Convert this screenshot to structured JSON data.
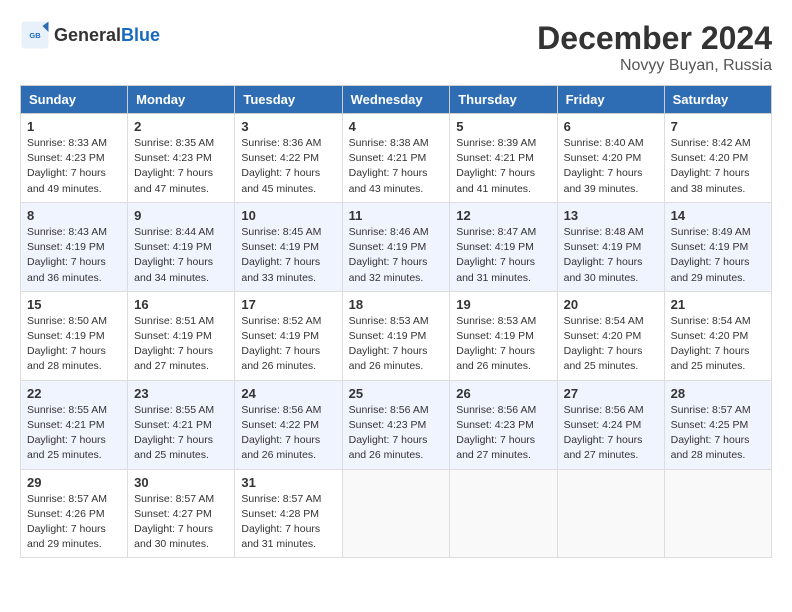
{
  "header": {
    "logo_general": "General",
    "logo_blue": "Blue",
    "month": "December 2024",
    "location": "Novyy Buyan, Russia"
  },
  "days_of_week": [
    "Sunday",
    "Monday",
    "Tuesday",
    "Wednesday",
    "Thursday",
    "Friday",
    "Saturday"
  ],
  "weeks": [
    [
      {
        "day": 1,
        "sunrise": "8:33 AM",
        "sunset": "4:23 PM",
        "daylight": "7 hours and 49 minutes."
      },
      {
        "day": 2,
        "sunrise": "8:35 AM",
        "sunset": "4:23 PM",
        "daylight": "7 hours and 47 minutes."
      },
      {
        "day": 3,
        "sunrise": "8:36 AM",
        "sunset": "4:22 PM",
        "daylight": "7 hours and 45 minutes."
      },
      {
        "day": 4,
        "sunrise": "8:38 AM",
        "sunset": "4:21 PM",
        "daylight": "7 hours and 43 minutes."
      },
      {
        "day": 5,
        "sunrise": "8:39 AM",
        "sunset": "4:21 PM",
        "daylight": "7 hours and 41 minutes."
      },
      {
        "day": 6,
        "sunrise": "8:40 AM",
        "sunset": "4:20 PM",
        "daylight": "7 hours and 39 minutes."
      },
      {
        "day": 7,
        "sunrise": "8:42 AM",
        "sunset": "4:20 PM",
        "daylight": "7 hours and 38 minutes."
      }
    ],
    [
      {
        "day": 8,
        "sunrise": "8:43 AM",
        "sunset": "4:19 PM",
        "daylight": "7 hours and 36 minutes."
      },
      {
        "day": 9,
        "sunrise": "8:44 AM",
        "sunset": "4:19 PM",
        "daylight": "7 hours and 34 minutes."
      },
      {
        "day": 10,
        "sunrise": "8:45 AM",
        "sunset": "4:19 PM",
        "daylight": "7 hours and 33 minutes."
      },
      {
        "day": 11,
        "sunrise": "8:46 AM",
        "sunset": "4:19 PM",
        "daylight": "7 hours and 32 minutes."
      },
      {
        "day": 12,
        "sunrise": "8:47 AM",
        "sunset": "4:19 PM",
        "daylight": "7 hours and 31 minutes."
      },
      {
        "day": 13,
        "sunrise": "8:48 AM",
        "sunset": "4:19 PM",
        "daylight": "7 hours and 30 minutes."
      },
      {
        "day": 14,
        "sunrise": "8:49 AM",
        "sunset": "4:19 PM",
        "daylight": "7 hours and 29 minutes."
      }
    ],
    [
      {
        "day": 15,
        "sunrise": "8:50 AM",
        "sunset": "4:19 PM",
        "daylight": "7 hours and 28 minutes."
      },
      {
        "day": 16,
        "sunrise": "8:51 AM",
        "sunset": "4:19 PM",
        "daylight": "7 hours and 27 minutes."
      },
      {
        "day": 17,
        "sunrise": "8:52 AM",
        "sunset": "4:19 PM",
        "daylight": "7 hours and 26 minutes."
      },
      {
        "day": 18,
        "sunrise": "8:53 AM",
        "sunset": "4:19 PM",
        "daylight": "7 hours and 26 minutes."
      },
      {
        "day": 19,
        "sunrise": "8:53 AM",
        "sunset": "4:19 PM",
        "daylight": "7 hours and 26 minutes."
      },
      {
        "day": 20,
        "sunrise": "8:54 AM",
        "sunset": "4:20 PM",
        "daylight": "7 hours and 25 minutes."
      },
      {
        "day": 21,
        "sunrise": "8:54 AM",
        "sunset": "4:20 PM",
        "daylight": "7 hours and 25 minutes."
      }
    ],
    [
      {
        "day": 22,
        "sunrise": "8:55 AM",
        "sunset": "4:21 PM",
        "daylight": "7 hours and 25 minutes."
      },
      {
        "day": 23,
        "sunrise": "8:55 AM",
        "sunset": "4:21 PM",
        "daylight": "7 hours and 25 minutes."
      },
      {
        "day": 24,
        "sunrise": "8:56 AM",
        "sunset": "4:22 PM",
        "daylight": "7 hours and 26 minutes."
      },
      {
        "day": 25,
        "sunrise": "8:56 AM",
        "sunset": "4:23 PM",
        "daylight": "7 hours and 26 minutes."
      },
      {
        "day": 26,
        "sunrise": "8:56 AM",
        "sunset": "4:23 PM",
        "daylight": "7 hours and 27 minutes."
      },
      {
        "day": 27,
        "sunrise": "8:56 AM",
        "sunset": "4:24 PM",
        "daylight": "7 hours and 27 minutes."
      },
      {
        "day": 28,
        "sunrise": "8:57 AM",
        "sunset": "4:25 PM",
        "daylight": "7 hours and 28 minutes."
      }
    ],
    [
      {
        "day": 29,
        "sunrise": "8:57 AM",
        "sunset": "4:26 PM",
        "daylight": "7 hours and 29 minutes."
      },
      {
        "day": 30,
        "sunrise": "8:57 AM",
        "sunset": "4:27 PM",
        "daylight": "7 hours and 30 minutes."
      },
      {
        "day": 31,
        "sunrise": "8:57 AM",
        "sunset": "4:28 PM",
        "daylight": "7 hours and 31 minutes."
      },
      null,
      null,
      null,
      null
    ]
  ]
}
